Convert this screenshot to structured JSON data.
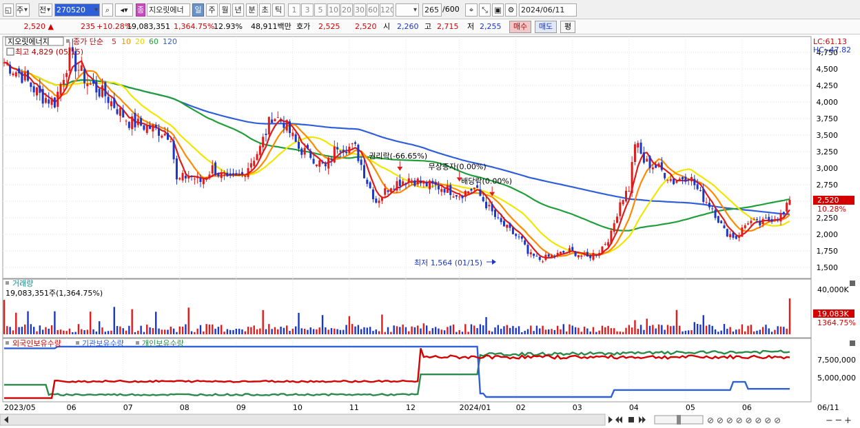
{
  "toolbar": {
    "type_label": "주",
    "scope_label": "전",
    "code": "270520",
    "stock_name": "지오릿에너",
    "tag_label": "종",
    "period_tabs": [
      "일",
      "주",
      "월",
      "년",
      "분",
      "초",
      "틱"
    ],
    "interval_buttons": [
      "1",
      "3",
      "5",
      "10",
      "20",
      "30",
      "60",
      "120"
    ],
    "count_value": "265",
    "count_total": "/600",
    "date_value": "2024/06/11"
  },
  "quote": {
    "price": "2,520",
    "change": "235",
    "change_pct": "+10.28%",
    "volume": "19,083,351",
    "volume_pct": "1,364.75%",
    "turnover": "12.93%",
    "amount": "48,911백만",
    "bid_label": "호가",
    "ask": "2,525",
    "bid": "2,520",
    "open_label": "시",
    "open": "2,260",
    "high_label": "고",
    "high": "2,715",
    "low_label": "저",
    "low": "2,255",
    "buy_label": "매수",
    "sell_label": "매도",
    "eval_label": "평"
  },
  "price_panel": {
    "stock_tag": "지오릿에너지",
    "ma_title": "종가 단순",
    "ma_periods": [
      "5",
      "10",
      "20",
      "60",
      "120"
    ],
    "ma_colors": [
      "#e01b1b",
      "#ff8a00",
      "#f2e600",
      "#1f9e3a",
      "#2f5fd8"
    ],
    "max_label": "최고 4,829 (05/15)",
    "min_label": "최저 1,564 (01/15)",
    "lc_label": "LC:61.13",
    "hc_label": "HC:-47.82",
    "last_price_label": "2,520",
    "last_pct_label": "10.28%",
    "events": [
      {
        "label": "권리락(-66.65%)",
        "index": 133
      },
      {
        "label": "무상증자(0.00%)",
        "index": 153
      },
      {
        "label": "배당락(0.00%)",
        "index": 164
      }
    ],
    "y_ticks": [
      "4,750",
      "4,500",
      "4,250",
      "4,000",
      "3,750",
      "3,500",
      "3,250",
      "3,000",
      "2,750",
      "2,500",
      "2,250",
      "2,000",
      "1,750",
      "1,500"
    ],
    "ylim": [
      1500,
      4750
    ]
  },
  "volume_panel": {
    "title": "거래량",
    "subtitle": "19,083,351주(1,364.75%)",
    "y_tick": "40,000K",
    "last_label": "19,083K",
    "last_pct_label": "1364.75%"
  },
  "holdings_panel": {
    "legend": [
      {
        "label": "외국인보유수량",
        "color": "#d40000"
      },
      {
        "label": "기관보유수량",
        "color": "#2f5fd8"
      },
      {
        "label": "개인보유수량",
        "color": "#2a8a4a"
      }
    ],
    "y_ticks": [
      "7,500,000",
      "5,000,000"
    ]
  },
  "x_axis": {
    "labels": [
      "2023/05",
      "06",
      "07",
      "08",
      "09",
      "10",
      "11",
      "12",
      "2024/01",
      "02",
      "03",
      "04",
      "05",
      "06"
    ],
    "right_label": "06/11"
  },
  "chart_data": {
    "type": "candlestick",
    "n": 265,
    "ylim": [
      1500,
      4750
    ],
    "anchors": [
      [
        0,
        4600
      ],
      [
        6,
        4400
      ],
      [
        12,
        4100
      ],
      [
        17,
        4000
      ],
      [
        22,
        4700
      ],
      [
        28,
        4300
      ],
      [
        34,
        4100
      ],
      [
        42,
        3700
      ],
      [
        50,
        3600
      ],
      [
        56,
        3500
      ],
      [
        58,
        2800
      ],
      [
        62,
        2900
      ],
      [
        66,
        2800
      ],
      [
        70,
        3000
      ],
      [
        75,
        2800
      ],
      [
        80,
        2900
      ],
      [
        86,
        3300
      ],
      [
        90,
        3800
      ],
      [
        94,
        3700
      ],
      [
        99,
        3300
      ],
      [
        103,
        3200
      ],
      [
        108,
        3000
      ],
      [
        112,
        3350
      ],
      [
        118,
        3300
      ],
      [
        122,
        2800
      ],
      [
        125,
        2500
      ],
      [
        130,
        2750
      ],
      [
        136,
        2850
      ],
      [
        142,
        2750
      ],
      [
        148,
        2700
      ],
      [
        153,
        2600
      ],
      [
        158,
        2700
      ],
      [
        162,
        2450
      ],
      [
        166,
        2200
      ],
      [
        170,
        2050
      ],
      [
        174,
        1900
      ],
      [
        176,
        1700
      ],
      [
        180,
        1620
      ],
      [
        185,
        1680
      ],
      [
        190,
        1750
      ],
      [
        196,
        1650
      ],
      [
        200,
        1750
      ],
      [
        204,
        2000
      ],
      [
        207,
        2500
      ],
      [
        210,
        2700
      ],
      [
        212,
        3400
      ],
      [
        215,
        3100
      ],
      [
        220,
        3000
      ],
      [
        225,
        2800
      ],
      [
        230,
        2900
      ],
      [
        234,
        2600
      ],
      [
        238,
        2400
      ],
      [
        242,
        2050
      ],
      [
        246,
        1950
      ],
      [
        250,
        2200
      ],
      [
        254,
        2150
      ],
      [
        258,
        2250
      ],
      [
        262,
        2300
      ],
      [
        264,
        2520
      ]
    ]
  }
}
